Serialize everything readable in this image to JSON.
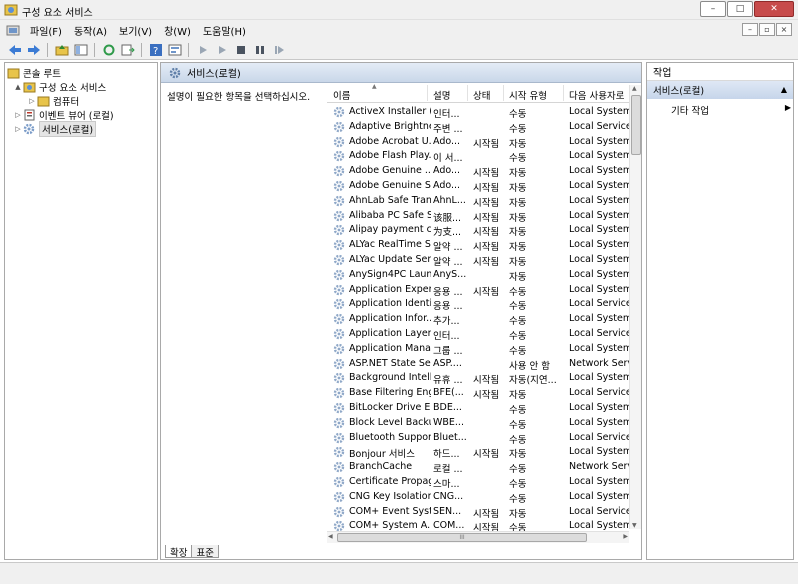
{
  "window": {
    "title": "구성 요소 서비스",
    "close_label": "✕",
    "minimize_label": "–",
    "maximize_label": "□"
  },
  "menu": [
    "파일(F)",
    "동작(A)",
    "보기(V)",
    "창(W)",
    "도움말(H)"
  ],
  "tree": {
    "items": [
      {
        "label": "콘솔 루트",
        "level": 0,
        "arrow": ""
      },
      {
        "label": "구성 요소 서비스",
        "level": 1,
        "arrow": "▲"
      },
      {
        "label": "컴퓨터",
        "level": 2,
        "arrow": "▷"
      },
      {
        "label": "이벤트 뷰어 (로컬)",
        "level": 1,
        "arrow": "▷"
      },
      {
        "label": "서비스(로컬)",
        "level": 1,
        "arrow": "▷",
        "selected": true
      }
    ]
  },
  "main": {
    "header": "서비스(로컬)",
    "description": "설명이 필요한 항목을 선택하십시오.",
    "columns": [
      "이름",
      "설명",
      "상태",
      "시작 유형",
      "다음 사용자로"
    ],
    "services": [
      [
        "ActiveX Installer (...",
        "인터...",
        "",
        "수동",
        "Local System"
      ],
      [
        "Adaptive Brightness",
        "주변 ...",
        "",
        "수동",
        "Local Service"
      ],
      [
        "Adobe Acrobat U...",
        "Ado...",
        "시작됨",
        "자동",
        "Local System"
      ],
      [
        "Adobe Flash Play...",
        "이 서...",
        "",
        "수동",
        "Local System"
      ],
      [
        "Adobe Genuine ...",
        "Ado...",
        "시작됨",
        "자동",
        "Local System"
      ],
      [
        "Adobe Genuine S...",
        "Ado...",
        "시작됨",
        "자동",
        "Local System"
      ],
      [
        "AhnLab Safe Tran...",
        "AhnL...",
        "시작됨",
        "자동",
        "Local System"
      ],
      [
        "Alibaba PC Safe S...",
        "该服...",
        "시작됨",
        "자동",
        "Local System"
      ],
      [
        "Alipay payment cl...",
        "为支...",
        "시작됨",
        "자동",
        "Local System"
      ],
      [
        "ALYac RealTime S...",
        "알약 ...",
        "시작됨",
        "자동",
        "Local System"
      ],
      [
        "ALYac Update Ser...",
        "알약 ...",
        "시작됨",
        "자동",
        "Local System"
      ],
      [
        "AnySign4PC Laun...",
        "AnyS...",
        "",
        "자동",
        "Local System"
      ],
      [
        "Application Experi...",
        "응용 ...",
        "시작됨",
        "수동",
        "Local System"
      ],
      [
        "Application Identity",
        "응용 ...",
        "",
        "수동",
        "Local Service"
      ],
      [
        "Application Infor...",
        "추가...",
        "",
        "수동",
        "Local System"
      ],
      [
        "Application Layer ...",
        "인터...",
        "",
        "수동",
        "Local Service"
      ],
      [
        "Application Mana...",
        "그룹 ...",
        "",
        "수동",
        "Local System"
      ],
      [
        "ASP.NET State Se...",
        "ASP....",
        "",
        "사용 안 함",
        "Network Servic"
      ],
      [
        "Background Intelli...",
        "유휴 ...",
        "시작됨",
        "자동(지연...",
        "Local System"
      ],
      [
        "Base Filtering Eng...",
        "BFE(...",
        "시작됨",
        "자동",
        "Local Service"
      ],
      [
        "BitLocker Drive E...",
        "BDE...",
        "",
        "수동",
        "Local System"
      ],
      [
        "Block Level Backu...",
        "WBE...",
        "",
        "수동",
        "Local System"
      ],
      [
        "Bluetooth Suppor...",
        "Bluet...",
        "",
        "수동",
        "Local Service"
      ],
      [
        "Bonjour 서비스",
        "하드...",
        "시작됨",
        "자동",
        "Local System"
      ],
      [
        "BranchCache",
        "로컬 ...",
        "",
        "수동",
        "Network Servic"
      ],
      [
        "Certificate Propag...",
        "스마...",
        "",
        "수동",
        "Local System"
      ],
      [
        "CNG Key Isolation",
        "CNG...",
        "",
        "수동",
        "Local System"
      ],
      [
        "COM+ Event Syst...",
        "SEN...",
        "시작됨",
        "자동",
        "Local Service"
      ],
      [
        "COM+ System A...",
        "COM...",
        "시작됨",
        "수동",
        "Local System"
      ]
    ],
    "hscroll_label": "III",
    "tabs": [
      "확장",
      "표준"
    ]
  },
  "actions": {
    "title": "작업",
    "section": "서비스(로컬)",
    "item": "기타 작업"
  },
  "colors": {
    "header_blue": "#c9d7e9",
    "gear": "#7b9cc8"
  }
}
